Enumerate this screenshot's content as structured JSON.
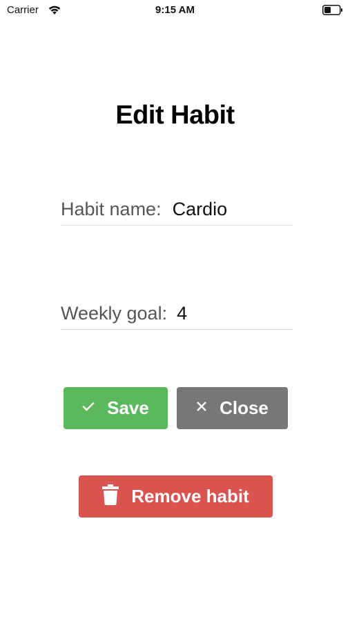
{
  "status_bar": {
    "carrier": "Carrier",
    "time": "9:15 AM",
    "wifi_icon": "wifi-icon",
    "battery_icon": "battery-icon"
  },
  "page": {
    "title": "Edit Habit"
  },
  "form": {
    "habit_name": {
      "label": "Habit name:",
      "value": "Cardio"
    },
    "weekly_goal": {
      "label": "Weekly goal:",
      "value": "4"
    }
  },
  "actions": {
    "save": {
      "label": "Save",
      "icon": "check-icon",
      "color": "#5cb85c"
    },
    "close": {
      "label": "Close",
      "icon": "close-icon",
      "color": "#777777"
    },
    "remove": {
      "label": "Remove habit",
      "icon": "trash-icon",
      "color": "#d9534f"
    }
  }
}
